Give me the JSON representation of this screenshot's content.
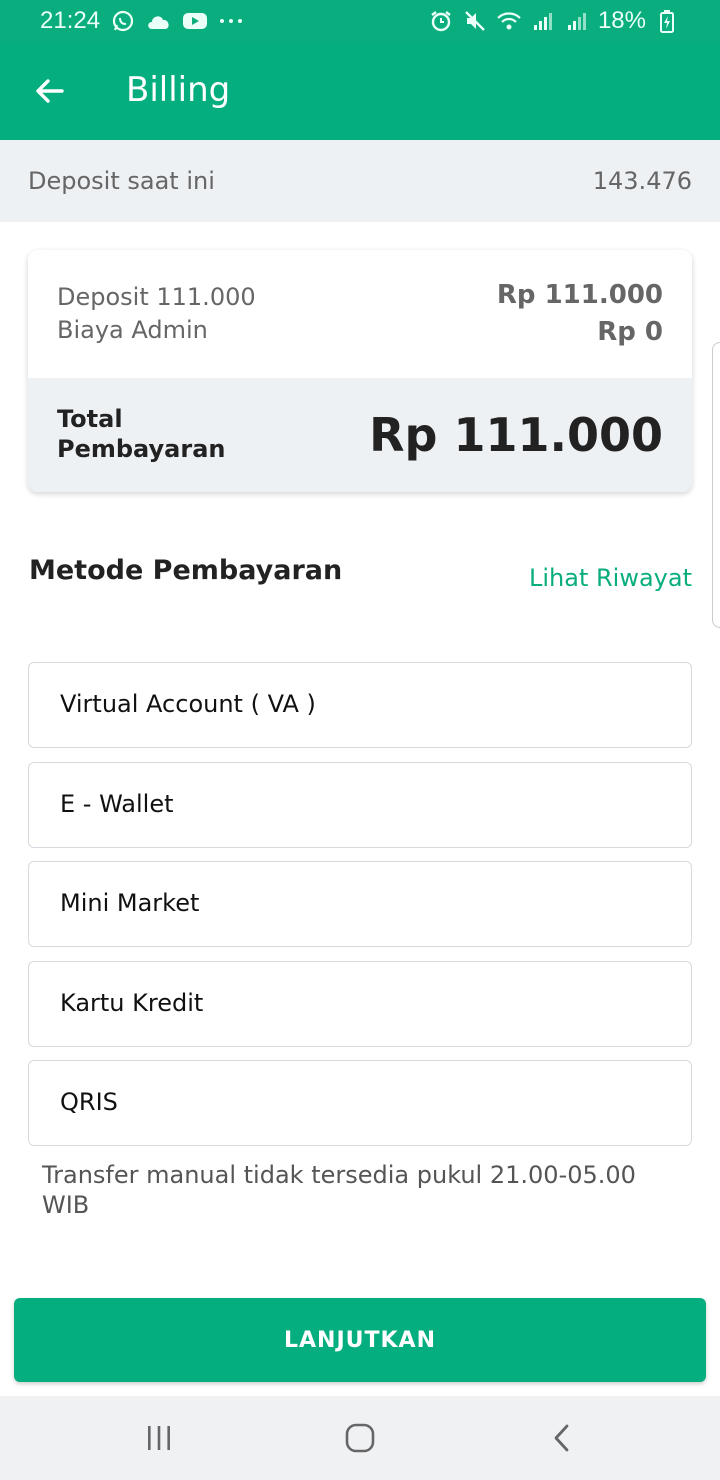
{
  "status_bar": {
    "time": "21:24",
    "battery": "18%",
    "icons_left": [
      "whatsapp-icon",
      "cloud-icon",
      "youtube-icon",
      "more-dots-icon"
    ],
    "icons_right": [
      "alarm-icon",
      "mute-icon",
      "wifi-icon",
      "signal-icon",
      "signal-icon",
      "battery-charging-icon"
    ]
  },
  "app_bar": {
    "title": "Billing",
    "back_icon": "arrow-left-icon",
    "background": "#05ae7f"
  },
  "deposit": {
    "label": "Deposit saat ini",
    "value": "143.476"
  },
  "summary": {
    "rows": [
      {
        "label": "Deposit 111.000",
        "value": "Rp 111.000"
      },
      {
        "label": "Biaya Admin",
        "value": "Rp 0"
      }
    ],
    "total_label": "Total Pembayaran",
    "total_value": "Rp 111.000"
  },
  "payment_methods": {
    "title": "Metode Pembayaran",
    "history_link": "Lihat Riwayat",
    "items": [
      {
        "label": "Virtual Account ( VA )"
      },
      {
        "label": "E - Wallet"
      },
      {
        "label": "Mini Market"
      },
      {
        "label": "Kartu Kredit"
      },
      {
        "label": "QRIS"
      }
    ]
  },
  "notice": "Transfer manual tidak tersedia pukul 21.00-05.00 WIB",
  "primary_button": {
    "label": "LANJUTKAN"
  },
  "nav_bar": {
    "buttons": [
      "recent-apps-icon",
      "home-icon",
      "back-icon"
    ]
  },
  "colors": {
    "accent": "#05ae7f",
    "link": "#0aae7e",
    "surface_grey": "#eef1f4"
  }
}
